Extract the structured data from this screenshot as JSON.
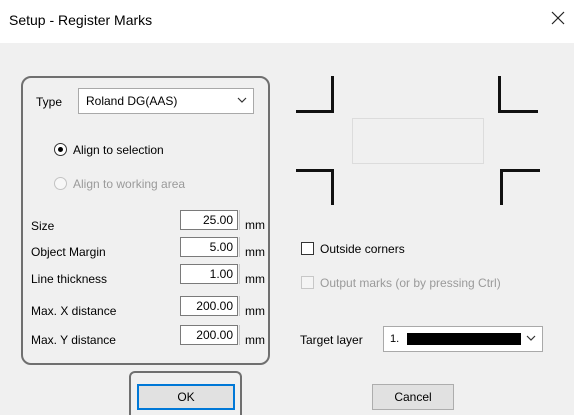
{
  "window": {
    "title": "Setup - Register Marks",
    "close_icon": "close-icon"
  },
  "type_field": {
    "label": "Type",
    "value": "Roland DG(AAS)"
  },
  "align": {
    "selection_label": "Align to selection",
    "selection_checked": true,
    "working_area_label": "Align to working area",
    "working_area_enabled": false
  },
  "fields": [
    {
      "label": "Size",
      "value": "25.00",
      "unit": "mm"
    },
    {
      "label": "Object Margin",
      "value": "5.00",
      "unit": "mm"
    },
    {
      "label": "Line thickness",
      "value": "1.00",
      "unit": "mm"
    },
    {
      "label": "Max. X distance",
      "value": "200.00",
      "unit": "mm"
    },
    {
      "label": "Max. Y distance",
      "value": "200.00",
      "unit": "mm"
    }
  ],
  "options": {
    "outside_corners_label": "Outside corners",
    "outside_corners_checked": false,
    "output_marks_label": "Output marks (or by pressing Ctrl)",
    "output_marks_enabled": false
  },
  "target_layer": {
    "label": "Target layer",
    "value": "1.",
    "swatch_color": "#000000"
  },
  "buttons": {
    "ok": "OK",
    "cancel": "Cancel"
  },
  "colors": {
    "dialog_bg": "#f0f0f0",
    "default_button_border": "#0078d7",
    "disabled_text": "#9a9a9a"
  }
}
